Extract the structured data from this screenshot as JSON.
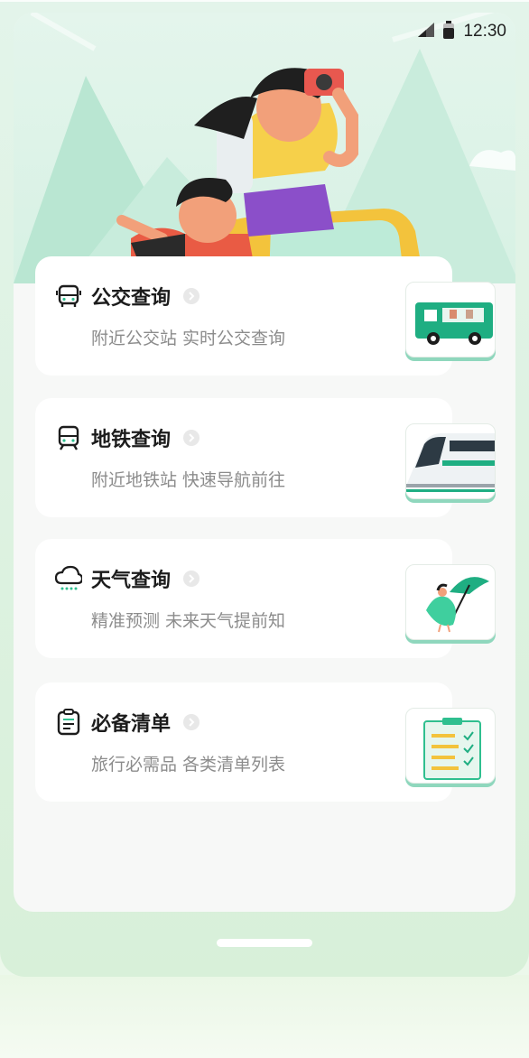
{
  "status_bar": {
    "time": "12:30"
  },
  "cards": [
    {
      "title": "公交查询",
      "subtitle": "附近公交站 实时公交查询",
      "icon": "bus-icon",
      "thumb": "bus-illustration"
    },
    {
      "title": "地铁查询",
      "subtitle": "附近地铁站 快速导航前往",
      "icon": "metro-icon",
      "thumb": "train-illustration"
    },
    {
      "title": "天气查询",
      "subtitle": "精准预测 未来天气提前知",
      "icon": "cloud-icon",
      "thumb": "umbrella-illustration"
    },
    {
      "title": "必备清单",
      "subtitle": "旅行必需品 各类清单列表",
      "icon": "clipboard-icon",
      "thumb": "checklist-illustration"
    }
  ],
  "colors": {
    "accent": "#2fbf8f",
    "title": "#1c1c1c",
    "subtitle": "#8c8c8c",
    "card": "#ffffff",
    "hero_bg": "#d7f1e4"
  }
}
